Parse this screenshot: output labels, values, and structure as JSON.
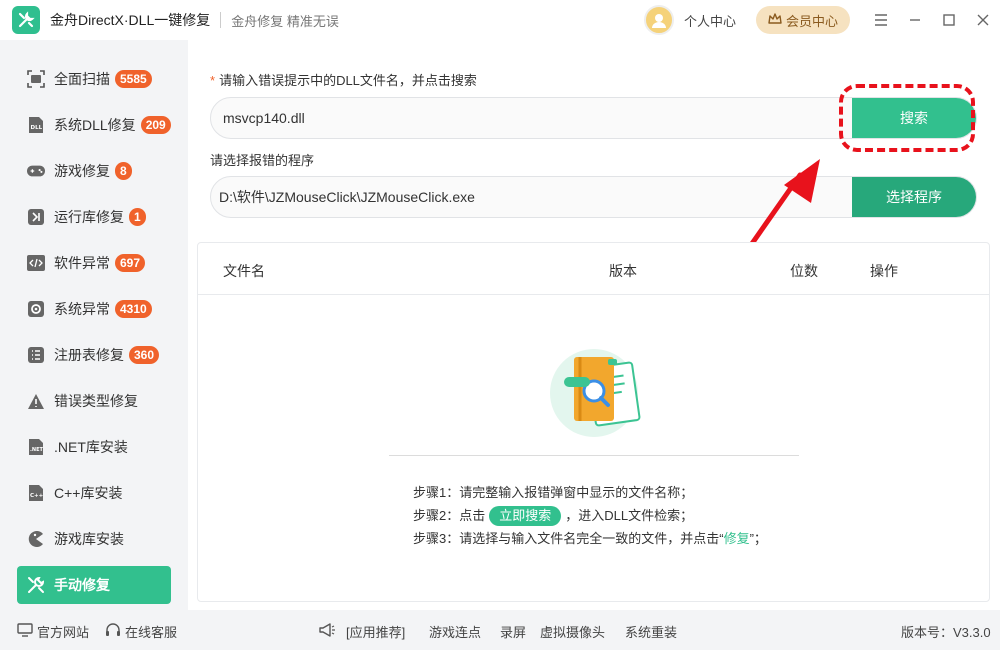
{
  "titlebar": {
    "app_title": "金舟DirectX·DLL一键修复",
    "slogan": "金舟修复 精准无误",
    "user_center": "个人中心",
    "vip_label": "会员中心"
  },
  "sidebar": {
    "items": [
      {
        "label": "全面扫描",
        "badge": "5585",
        "icon": "scan-icon"
      },
      {
        "label": "系统DLL修复",
        "badge": "209",
        "icon": "dll-icon"
      },
      {
        "label": "游戏修复",
        "badge": "8",
        "icon": "gamepad-icon"
      },
      {
        "label": "运行库修复",
        "badge": "1",
        "icon": "runtime-icon"
      },
      {
        "label": "软件异常",
        "badge": "697",
        "icon": "code-icon"
      },
      {
        "label": "系统异常",
        "badge": "4310",
        "icon": "gear-icon"
      },
      {
        "label": "注册表修复",
        "badge": "360",
        "icon": "list-icon"
      },
      {
        "label": "错误类型修复",
        "badge": "",
        "icon": "warning-icon"
      },
      {
        "label": ".NET库安装",
        "badge": "",
        "icon": "net-icon"
      },
      {
        "label": "C++库安装",
        "badge": "",
        "icon": "cpp-icon"
      },
      {
        "label": "游戏库安装",
        "badge": "",
        "icon": "pacman-icon"
      },
      {
        "label": "手动修复",
        "badge": "",
        "icon": "wrench-icon"
      }
    ]
  },
  "main": {
    "dll_label_star": "*",
    "dll_label": "请输入错误提示中的DLL文件名，并点击搜索",
    "dll_input_value": "msvcp140.dll",
    "search_button": "搜索",
    "program_label": "请选择报错的程序",
    "program_input_value": "D:\\软件\\JZMouseClick\\JZMouseClick.exe",
    "choose_button": "选择程序",
    "table": {
      "columns": [
        "文件名",
        "版本",
        "位数",
        "操作"
      ]
    },
    "steps": {
      "step1": "步骤1：请完整输入报错弹窗中显示的文件名称；",
      "step2_prefix": "步骤2：点击",
      "step2_pill": "立即搜索",
      "step2_suffix": "，进入DLL文件检索；",
      "step3_prefix": "步骤3：请选择与输入文件名完全一致的文件，并点击“",
      "step3_fix": "修复",
      "step3_suffix": "”；"
    }
  },
  "footer": {
    "website": "官方网站",
    "service": "在线客服",
    "recommend": "[应用推荐]",
    "links": [
      "游戏连点",
      "录屏",
      "虚拟摄像头",
      "系统重装"
    ],
    "version": "版本号：V3.3.0"
  },
  "colors": {
    "accent": "#32c08e",
    "badge": "#f0622b",
    "highlight": "#e8121c"
  }
}
